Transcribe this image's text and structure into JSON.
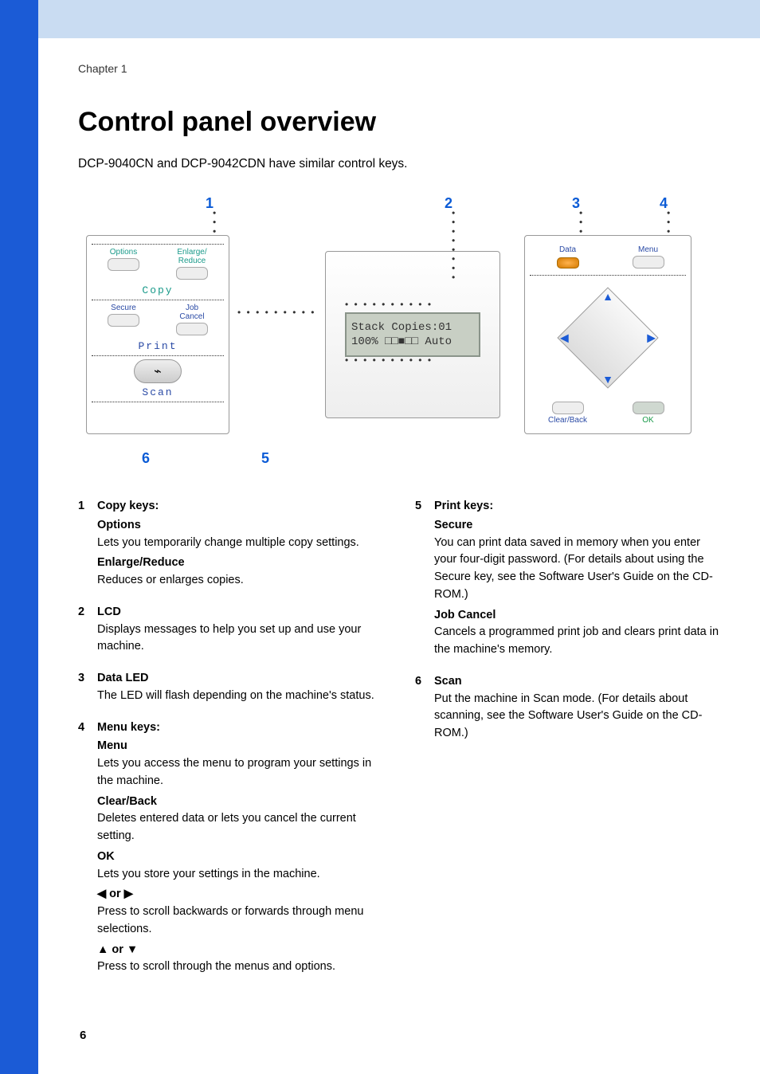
{
  "chapter": "Chapter 1",
  "title": "Control panel overview",
  "intro": "DCP-9040CN and DCP-9042CDN have similar control keys.",
  "diagram": {
    "callouts": {
      "n1": "1",
      "n2": "2",
      "n3": "3",
      "n4": "4",
      "n5": "5",
      "n6": "6"
    },
    "left_panel": {
      "options": "Options",
      "enlarge_reduce": "Enlarge/\nReduce",
      "copy": "Copy",
      "secure": "Secure",
      "job_cancel": "Job\nCancel",
      "print": "Print",
      "scan": "Scan"
    },
    "lcd": {
      "line1": "Stack  Copies:01",
      "line2": "100%   □□■□□ Auto"
    },
    "right_panel": {
      "data": "Data",
      "menu": "Menu",
      "clear_back": "Clear/Back",
      "ok": "OK"
    }
  },
  "left_col": {
    "i1": {
      "num": "1",
      "title": "Copy keys:",
      "options_h": "Options",
      "options_t": "Lets you temporarily change multiple copy settings.",
      "er_h": "Enlarge/Reduce",
      "er_t": "Reduces or enlarges copies."
    },
    "i2": {
      "num": "2",
      "title": "LCD",
      "t": "Displays messages to help you set up and use your machine."
    },
    "i3": {
      "num": "3",
      "title": "Data LED",
      "t": "The LED will flash depending on the machine's status."
    },
    "i4": {
      "num": "4",
      "title": "Menu keys:",
      "menu_h": "Menu",
      "menu_t": "Lets you access the menu to program your settings in the machine.",
      "cb_h": "Clear/Back",
      "cb_t": "Deletes entered data or lets you cancel the current setting.",
      "ok_h": "OK",
      "ok_t": "Lets you store your settings in the machine.",
      "lr_h": "◀ or ▶",
      "lr_t": "Press to scroll backwards or forwards through menu selections.",
      "ud_h": "▲ or ▼",
      "ud_t": "Press to scroll through the menus and options."
    }
  },
  "right_col": {
    "i5": {
      "num": "5",
      "title": "Print keys:",
      "sec_h": "Secure",
      "sec_t": "You can print data saved in memory when you enter your four-digit password. (For details about using the Secure key, see the Software User's Guide on the CD-ROM.)",
      "jc_h": "Job Cancel",
      "jc_t": "Cancels a programmed print job and clears print data in the machine's memory."
    },
    "i6": {
      "num": "6",
      "title": "Scan",
      "t": "Put the machine in Scan mode. (For details about scanning, see the Software User's Guide on the CD-ROM.)"
    }
  },
  "page_number": "6"
}
